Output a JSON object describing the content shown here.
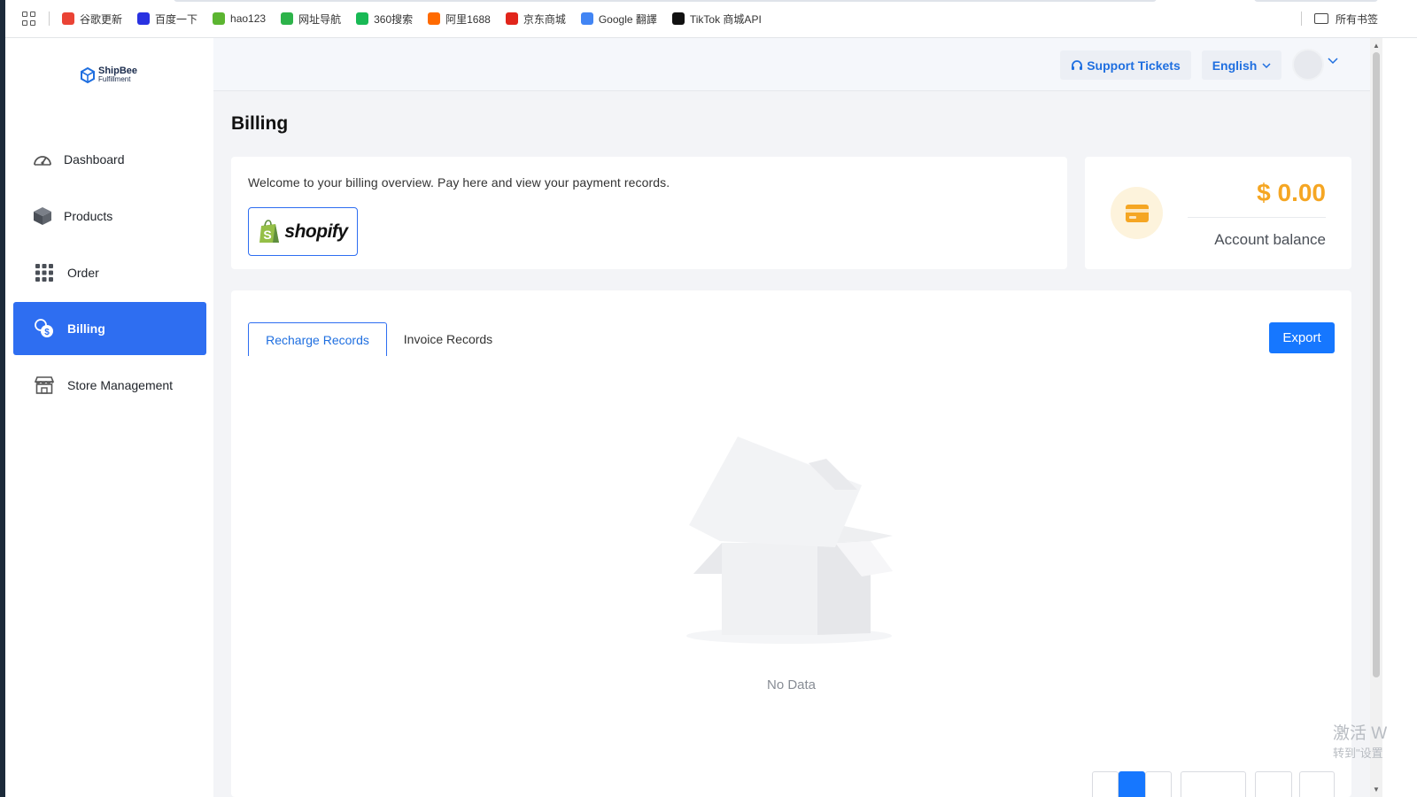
{
  "bookmarks": {
    "items": [
      {
        "label": "谷歌更新",
        "color": "#ea4335"
      },
      {
        "label": "百度一下",
        "color": "#2932e1"
      },
      {
        "label": "hao123",
        "color": "#5cb531"
      },
      {
        "label": "网址导航",
        "color": "#2db34a"
      },
      {
        "label": "360搜索",
        "color": "#19b955"
      },
      {
        "label": "阿里1688",
        "color": "#ff6a00"
      },
      {
        "label": "京东商城",
        "color": "#e1251b"
      },
      {
        "label": "Google 翻譯",
        "color": "#4285f4"
      },
      {
        "label": "TikTok 商城API",
        "color": "#111111"
      }
    ],
    "all_bookmarks": "所有书签"
  },
  "sidebar": {
    "logo": {
      "line1": "ShipBee",
      "line2": "Fulfillment"
    },
    "items": [
      {
        "label": "Dashboard",
        "icon": "speedometer-icon"
      },
      {
        "label": "Products",
        "icon": "box-icon"
      },
      {
        "label": "Order",
        "icon": "grid-icon"
      },
      {
        "label": "Billing",
        "icon": "coins-icon"
      },
      {
        "label": "Store Management",
        "icon": "store-icon"
      }
    ],
    "active_item": "Billing"
  },
  "header": {
    "support_label": "Support Tickets",
    "language": "English"
  },
  "page": {
    "title": "Billing",
    "welcome_text": "Welcome to your billing overview. Pay here and view your payment records.",
    "shopify_label": "shopify",
    "balance_amount": "$ 0.00",
    "balance_label": "Account balance",
    "tabs": [
      "Recharge Records",
      "Invoice Records"
    ],
    "active_tab": "Recharge Records",
    "export_label": "Export",
    "empty_text": "No Data"
  },
  "colors": {
    "primary": "#2e6ef1",
    "accent_amount": "#f5a623",
    "export": "#1677ff"
  },
  "watermark": {
    "line1": "激活 W",
    "line2": "转到\"设置"
  }
}
